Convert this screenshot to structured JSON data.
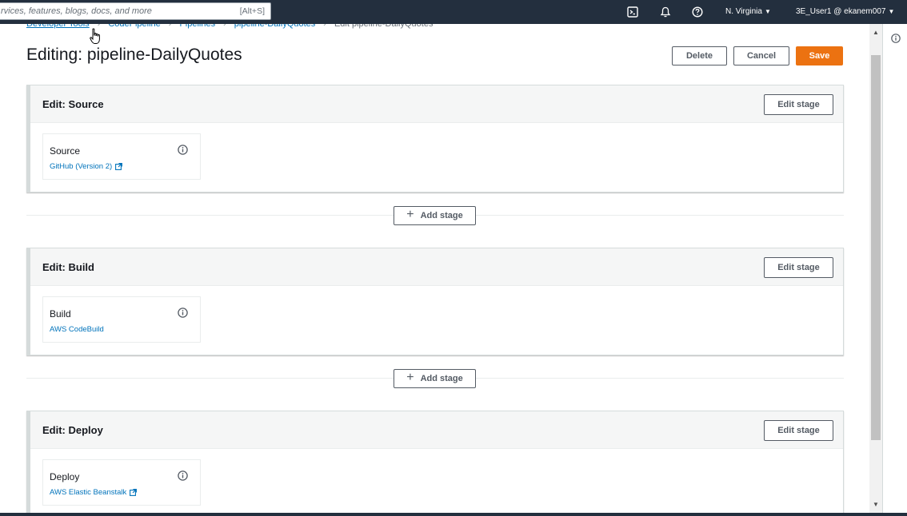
{
  "topnav": {
    "search_placeholder": "rvices, features, blogs, docs, and more",
    "search_shortcut": "[Alt+S]",
    "region": "N. Virginia",
    "account": "3E_User1 @ ekanem007",
    "icons": [
      "cloudshell-icon",
      "bell-icon",
      "help-icon"
    ]
  },
  "breadcrumb": {
    "items": [
      "Developer Tools",
      "CodePipeline",
      "Pipelines",
      "pipeline-DailyQuotes"
    ],
    "current": "Edit pipeline-DailyQuotes"
  },
  "page": {
    "title": "Editing: pipeline-DailyQuotes",
    "delete_label": "Delete",
    "cancel_label": "Cancel",
    "save_label": "Save"
  },
  "stages": [
    {
      "title": "Edit: Source",
      "edit_label": "Edit stage",
      "action": {
        "name": "Source",
        "provider": "GitHub (Version 2)",
        "external_link": true
      }
    },
    {
      "title": "Edit: Build",
      "edit_label": "Edit stage",
      "action": {
        "name": "Build",
        "provider": "AWS CodeBuild",
        "external_link": false
      }
    },
    {
      "title": "Edit: Deploy",
      "edit_label": "Edit stage",
      "action": {
        "name": "Deploy",
        "provider": "AWS Elastic Beanstalk",
        "external_link": true
      }
    }
  ],
  "add_stage_label": "Add stage",
  "colors": {
    "nav_bg": "#232f3e",
    "primary": "#ec7211",
    "link": "#0073bb"
  }
}
